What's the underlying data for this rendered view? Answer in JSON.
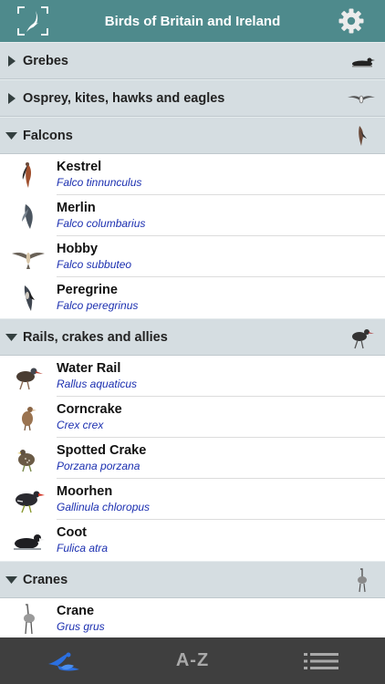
{
  "header": {
    "title": "Birds of Britain and Ireland"
  },
  "sections": [
    {
      "label": "Grebes",
      "expanded": false,
      "icon": "grebe-silhouette-icon"
    },
    {
      "label": "Osprey, kites, hawks and eagles",
      "expanded": false,
      "icon": "eagle-silhouette-icon"
    },
    {
      "label": "Falcons",
      "expanded": true,
      "icon": "falcon-silhouette-icon"
    },
    {
      "label": "Rails, crakes and allies",
      "expanded": true,
      "icon": "rail-silhouette-icon"
    },
    {
      "label": "Cranes",
      "expanded": true,
      "icon": "crane-silhouette-icon"
    }
  ],
  "falcons": [
    {
      "common": "Kestrel",
      "latin": "Falco tinnunculus"
    },
    {
      "common": "Merlin",
      "latin": "Falco columbarius"
    },
    {
      "common": "Hobby",
      "latin": "Falco subbuteo"
    },
    {
      "common": "Peregrine",
      "latin": "Falco peregrinus"
    }
  ],
  "rails": [
    {
      "common": "Water Rail",
      "latin": "Rallus aquaticus"
    },
    {
      "common": "Corncrake",
      "latin": "Crex crex"
    },
    {
      "common": "Spotted Crake",
      "latin": "Porzana porzana"
    },
    {
      "common": "Moorhen",
      "latin": "Gallinula chloropus"
    },
    {
      "common": "Coot",
      "latin": "Fulica atra"
    }
  ],
  "cranes": [
    {
      "common": "Crane",
      "latin": "Grus grus"
    }
  ],
  "tabbar": {
    "az_label": "A-Z"
  },
  "colors": {
    "header": "#4e8a8c",
    "section": "#d5dde1",
    "latin": "#1b2fb0",
    "tab_active": "#2b6fe0",
    "tabbar": "#3f3f3f"
  }
}
